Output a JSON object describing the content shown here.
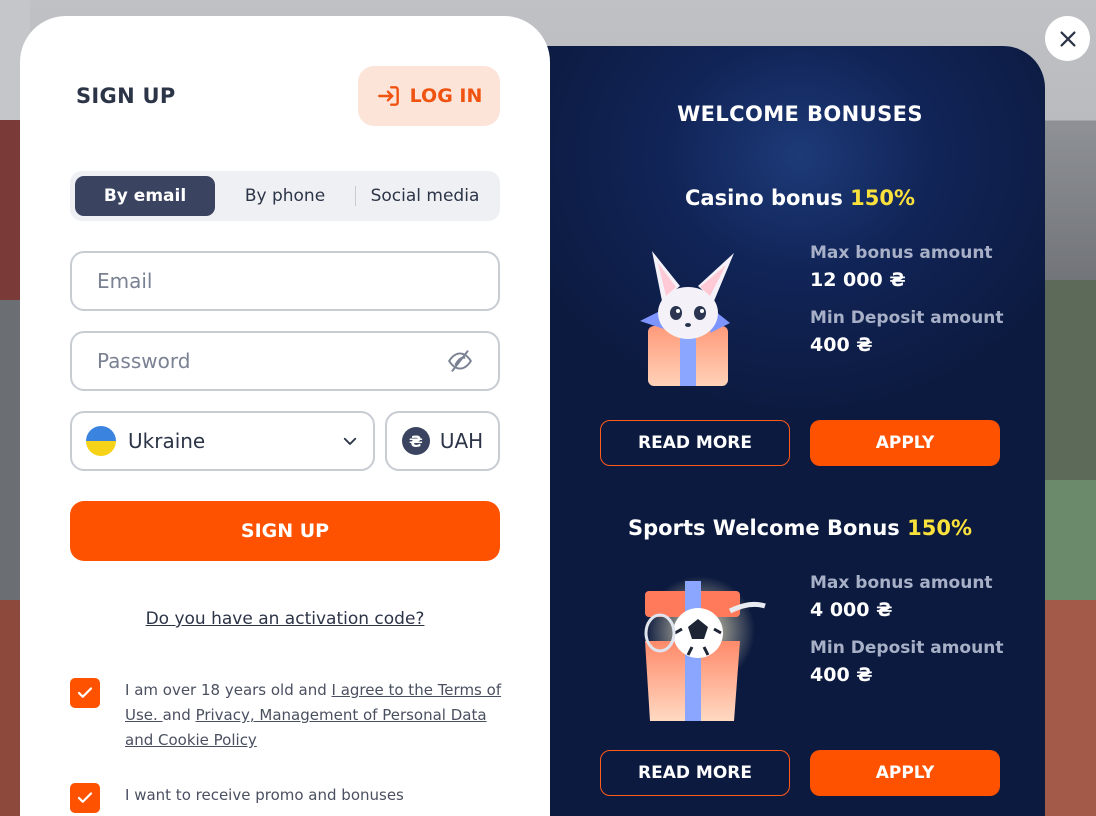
{
  "signup": {
    "title": "SIGN UP",
    "login_label": "LOG IN",
    "tabs": [
      {
        "label": "By email",
        "active": true
      },
      {
        "label": "By phone",
        "active": false
      },
      {
        "label": "Social media",
        "active": false
      }
    ],
    "email_placeholder": "Email",
    "password_placeholder": "Password",
    "country": "Ukraine",
    "currency": "UAH",
    "currency_symbol": "₴",
    "submit_label": "SIGN UP",
    "activation_link": "Do you have an activation code?",
    "consent": {
      "prefix": "I am over 18 years old and ",
      "terms_link": "I agree to the Terms of Use. ",
      "middle": "and ",
      "privacy_link": "Privacy, Management of Personal Data and Cookie Policy",
      "checked": true
    },
    "promo": {
      "text": "I want to receive promo and bonuses",
      "checked": true
    }
  },
  "bonuses": {
    "title": "WELCOME BONUSES",
    "items": [
      {
        "name": "Casino bonus",
        "percent": "150%",
        "max_label": "Max bonus amount",
        "max_value": "12 000 ₴",
        "min_label": "Min Deposit amount",
        "min_value": "400 ₴",
        "read_more": "READ MORE",
        "apply": "APPLY",
        "image": "fox-gift-icon"
      },
      {
        "name": "Sports Welcome Bonus",
        "percent": "150%",
        "max_label": "Max bonus amount",
        "max_value": "4 000 ₴",
        "min_label": "Min Deposit amount",
        "min_value": "400 ₴",
        "read_more": "READ MORE",
        "apply": "APPLY",
        "image": "sports-gift-icon"
      }
    ]
  },
  "colors": {
    "accent": "#ff5200",
    "highlight": "#fbe13c",
    "panel_dark": "#0c1a3f",
    "tab_active": "#3a4360"
  }
}
